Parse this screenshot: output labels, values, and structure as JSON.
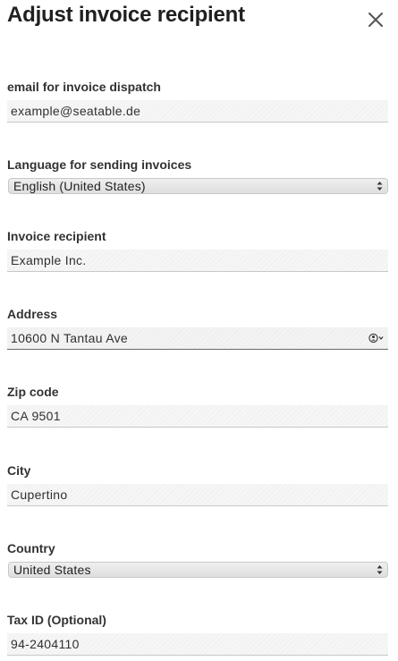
{
  "dialog": {
    "title": "Adjust invoice recipient"
  },
  "fields": {
    "email": {
      "label": "email for invoice dispatch",
      "value": "example@seatable.de"
    },
    "language": {
      "label": "Language for sending invoices",
      "selected": "English (United States)"
    },
    "recipient": {
      "label": "Invoice recipient",
      "value": "Example Inc."
    },
    "address": {
      "label": "Address",
      "value": "10600 N Tantau Ave"
    },
    "zip": {
      "label": "Zip code",
      "value": "CA 9501"
    },
    "city": {
      "label": "City",
      "value": "Cupertino"
    },
    "country": {
      "label": "Country",
      "selected": "United States"
    },
    "tax_id": {
      "label": "Tax ID (Optional)",
      "value": "94-2404110"
    }
  },
  "icons": {
    "close": "close-icon",
    "select_arrows": "select-arrows-icon",
    "contact_autofill": "contact-autofill-icon"
  }
}
